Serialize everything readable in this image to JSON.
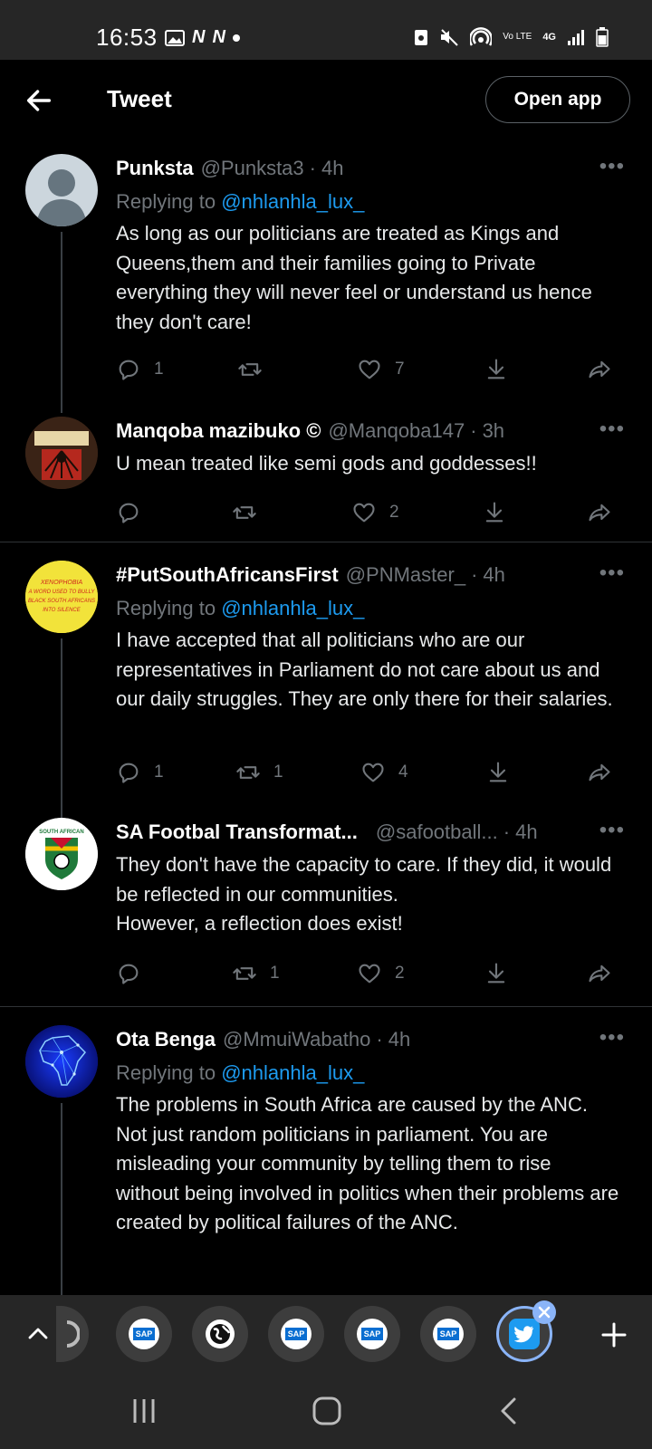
{
  "status_bar": {
    "time": "16:53",
    "network": "4G",
    "volte": "Vo LTE",
    "left_icons": [
      "image-icon",
      "n-icon",
      "n-icon",
      "dot-icon"
    ],
    "right_icons": [
      "nfc-icon",
      "mute-icon",
      "hotspot-icon",
      "volte-icon",
      "network-4g-icon",
      "signal-icon",
      "battery-icon"
    ]
  },
  "header": {
    "title": "Tweet",
    "open_app_label": "Open app"
  },
  "tweets": [
    {
      "name": "Punksta",
      "handle": "@Punksta3",
      "time": "4h",
      "replying_prefix": "Replying to",
      "replying_to": "@nhlanhla_lux_",
      "text": "As long as our politicians are treated as Kings and Queens,them and their families going to Private everything they will never feel or understand us hence they don't care!",
      "reply_count": "1",
      "retweet_count": "",
      "like_count": "7"
    },
    {
      "name": "Manqoba mazibuko ©",
      "handle": "@Manqoba147",
      "time": "3h",
      "avatar_text": "ANIMAL FARM",
      "text": "U mean treated like semi gods and goddesses!!",
      "reply_count": "",
      "retweet_count": "",
      "like_count": "2"
    },
    {
      "name": "#PutSouthAfricansFirst",
      "handle": "@PNMaster_",
      "time": "4h",
      "avatar_text": "XENOPHOBIA A WORD USED TO BULLY BLACK SOUTH AFRICANS INTO SILENCE",
      "replying_prefix": "Replying to",
      "replying_to": "@nhlanhla_lux_",
      "text": "I have accepted that all politicians who are our representatives in Parliament do not care about us and our daily struggles. They are only there for their salaries.",
      "reply_count": "1",
      "retweet_count": "1",
      "like_count": "4"
    },
    {
      "name": "SA Footbal Transformat...",
      "handle": "@safootball...",
      "time": "4h",
      "avatar_text": "SOUTH AFRICAN FOOTBALL TRANSFORMATION FORUM",
      "text": "They don't have the capacity to care. If they did, it would be reflected in our communities.\nHowever, a reflection does exist!",
      "reply_count": "",
      "retweet_count": "1",
      "like_count": "2"
    },
    {
      "name": "Ota Benga",
      "handle": "@MmuiWabatho",
      "time": "4h",
      "replying_prefix": "Replying to",
      "replying_to": "@nhlanhla_lux_",
      "text": "The problems  in South Africa are caused by the ANC. Not just random politicians in parliament. You are misleading your community by telling them to rise without being involved in politics when their problems are created by political failures  of the ANC."
    }
  ],
  "tray": {
    "sap_label": "SAP",
    "items": [
      "chevron-up-icon",
      "partial-tab-icon",
      "sap-icon",
      "globe-icon",
      "sap-icon",
      "sap-icon",
      "sap-icon",
      "twitter-icon",
      "plus-icon"
    ]
  },
  "navbar": {
    "buttons": [
      "recents-icon",
      "home-icon",
      "back-icon"
    ]
  },
  "colors": {
    "background": "#000000",
    "text": "#e7e9ea",
    "muted": "#71767b",
    "link": "#1d9bf0",
    "divider": "#2f3336",
    "bars": "#262626"
  }
}
